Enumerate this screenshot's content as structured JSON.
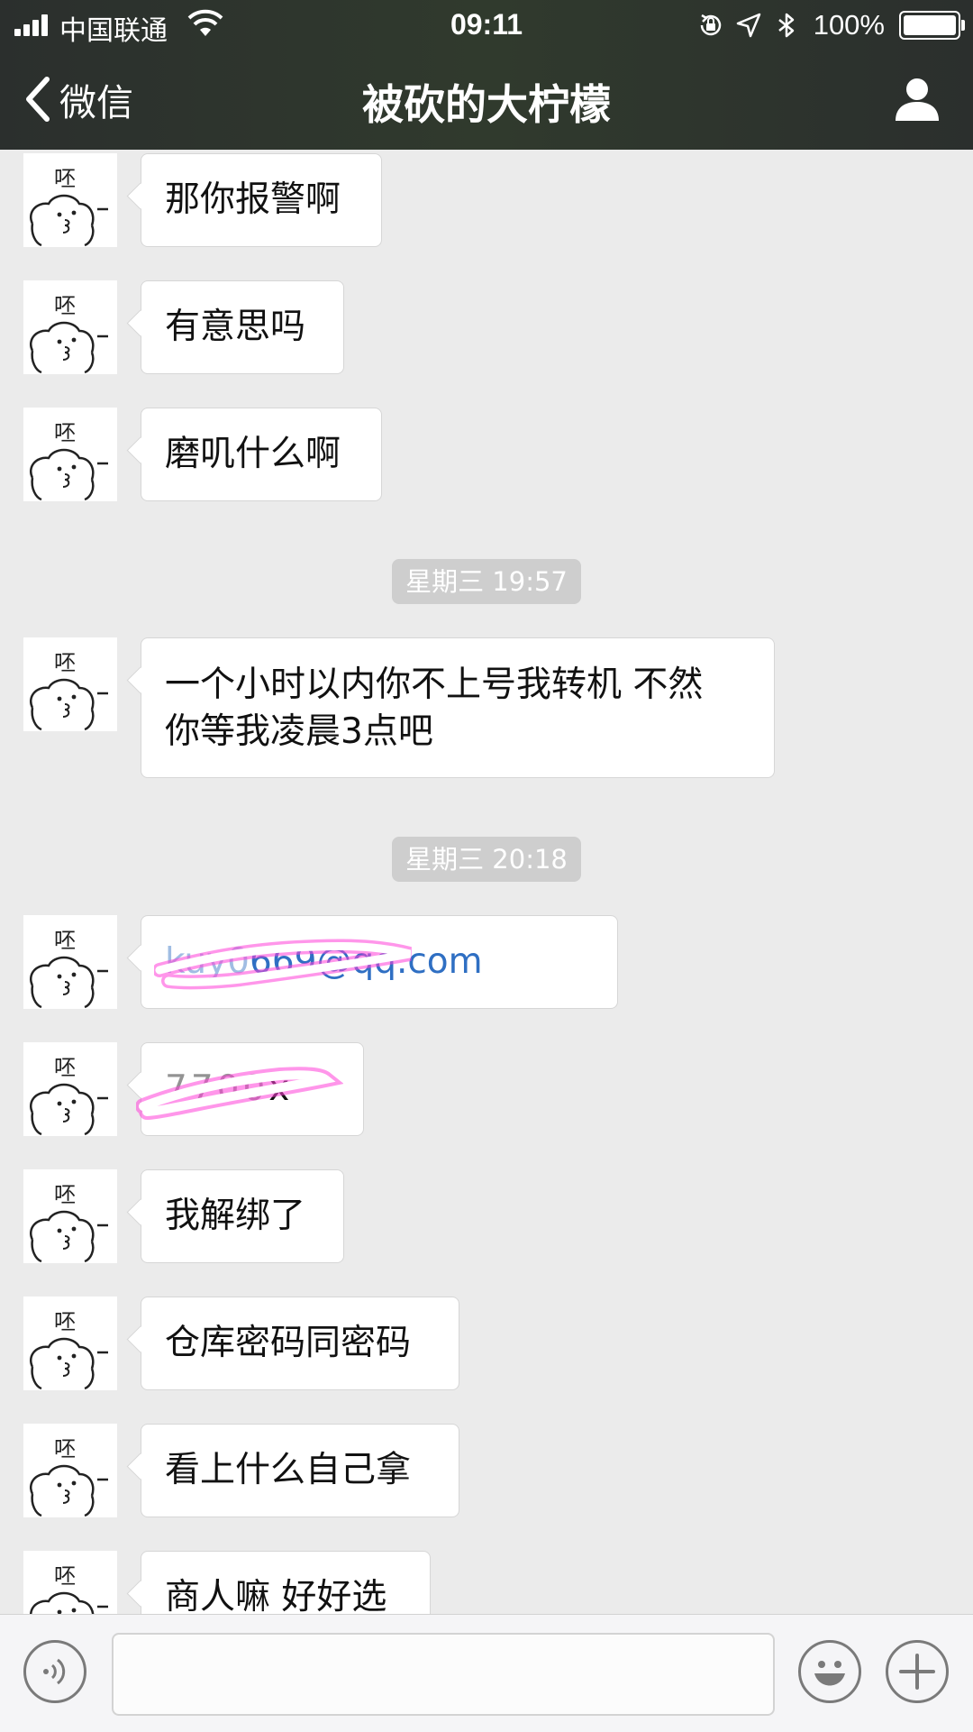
{
  "status_bar": {
    "carrier": "中国联通",
    "time": "09:11",
    "battery": "100%",
    "icons": [
      "signal-icon",
      "wifi-icon",
      "orientation-lock-icon",
      "location-icon",
      "bluetooth-icon",
      "battery-icon"
    ]
  },
  "nav": {
    "back_label": "微信",
    "title": "被砍的大柠檬",
    "icons": [
      "chevron-left-icon",
      "person-icon"
    ]
  },
  "chat": {
    "messages": [
      {
        "text": "那你报警啊"
      },
      {
        "text": "有意思吗"
      },
      {
        "text": "磨叽什么啊"
      },
      {
        "line1": "一个小时以内你不上号我转机 不然",
        "line2": "你等我凌晨3点吧"
      },
      {
        "prefix": "kuy0",
        "text": "669@qq.com"
      },
      {
        "prefix": "7700",
        "text": "x"
      },
      {
        "text": "我解绑了"
      },
      {
        "text": "仓库密码同密码"
      },
      {
        "text": "看上什么自己拿"
      },
      {
        "text": "商人嘛 好好选"
      }
    ],
    "timestamps": [
      "星期三 19:57",
      "星期三 20:18"
    ],
    "avatar_glyph": "呸",
    "link_color": "#2f6fc3",
    "redaction_color": "#ff3fd8"
  },
  "input_bar": {
    "icons": [
      "voice-icon",
      "emoji-icon",
      "plus-icon"
    ]
  }
}
